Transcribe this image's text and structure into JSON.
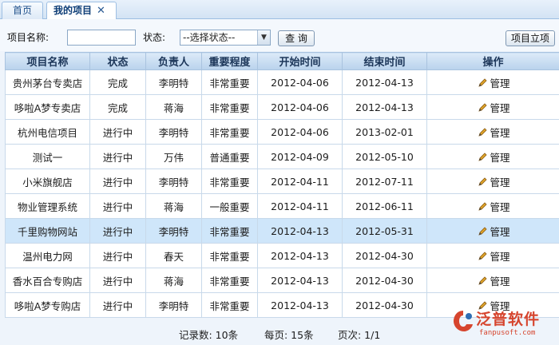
{
  "tabs": {
    "home": "首页",
    "active": "我的项目",
    "close_glyph": "✕"
  },
  "filters": {
    "name_label": "项目名称:",
    "name_value": "",
    "status_label": "状态:",
    "status_selected": "--选择状态--",
    "query_button": "查 询",
    "add_button": "项目立项"
  },
  "table": {
    "columns": [
      "项目名称",
      "状态",
      "负责人",
      "重要程度",
      "开始时间",
      "结束时间",
      "操作"
    ],
    "action_label": "管理",
    "rows": [
      {
        "name": "贵州茅台专卖店",
        "status": "完成",
        "owner": "李明特",
        "importance": "非常重要",
        "start": "2012-04-06",
        "end": "2012-04-13"
      },
      {
        "name": "哆啦A梦专卖店",
        "status": "完成",
        "owner": "蒋海",
        "importance": "非常重要",
        "start": "2012-04-06",
        "end": "2012-04-13"
      },
      {
        "name": "杭州电信项目",
        "status": "进行中",
        "owner": "李明特",
        "importance": "非常重要",
        "start": "2012-04-06",
        "end": "2013-02-01"
      },
      {
        "name": "测试一",
        "status": "进行中",
        "owner": "万伟",
        "importance": "普通重要",
        "start": "2012-04-09",
        "end": "2012-05-10"
      },
      {
        "name": "小米旗舰店",
        "status": "进行中",
        "owner": "李明特",
        "importance": "非常重要",
        "start": "2012-04-11",
        "end": "2012-07-11"
      },
      {
        "name": "物业管理系统",
        "status": "进行中",
        "owner": "蒋海",
        "importance": "一般重要",
        "start": "2012-04-11",
        "end": "2012-06-11"
      },
      {
        "name": "千里购物网站",
        "status": "进行中",
        "owner": "李明特",
        "importance": "非常重要",
        "start": "2012-04-13",
        "end": "2012-05-31"
      },
      {
        "name": "温州电力网",
        "status": "进行中",
        "owner": "春天",
        "importance": "非常重要",
        "start": "2012-04-13",
        "end": "2012-04-30"
      },
      {
        "name": "香水百合专购店",
        "status": "进行中",
        "owner": "蒋海",
        "importance": "非常重要",
        "start": "2012-04-13",
        "end": "2012-04-30"
      },
      {
        "name": "哆啦A梦专购店",
        "status": "进行中",
        "owner": "李明特",
        "importance": "非常重要",
        "start": "2012-04-13",
        "end": "2012-04-30"
      }
    ],
    "highlighted_row": 6
  },
  "footer": {
    "records": "记录数: 10条",
    "per_page": "每页: 15条",
    "page": "页次: 1/1"
  },
  "logo": {
    "brand": "泛普软件",
    "url": "fanpusoft.com"
  },
  "colors": {
    "header_bg": "#b9d2ec",
    "highlight_row": "#cfe6fa",
    "brand_red": "#d6452e"
  }
}
